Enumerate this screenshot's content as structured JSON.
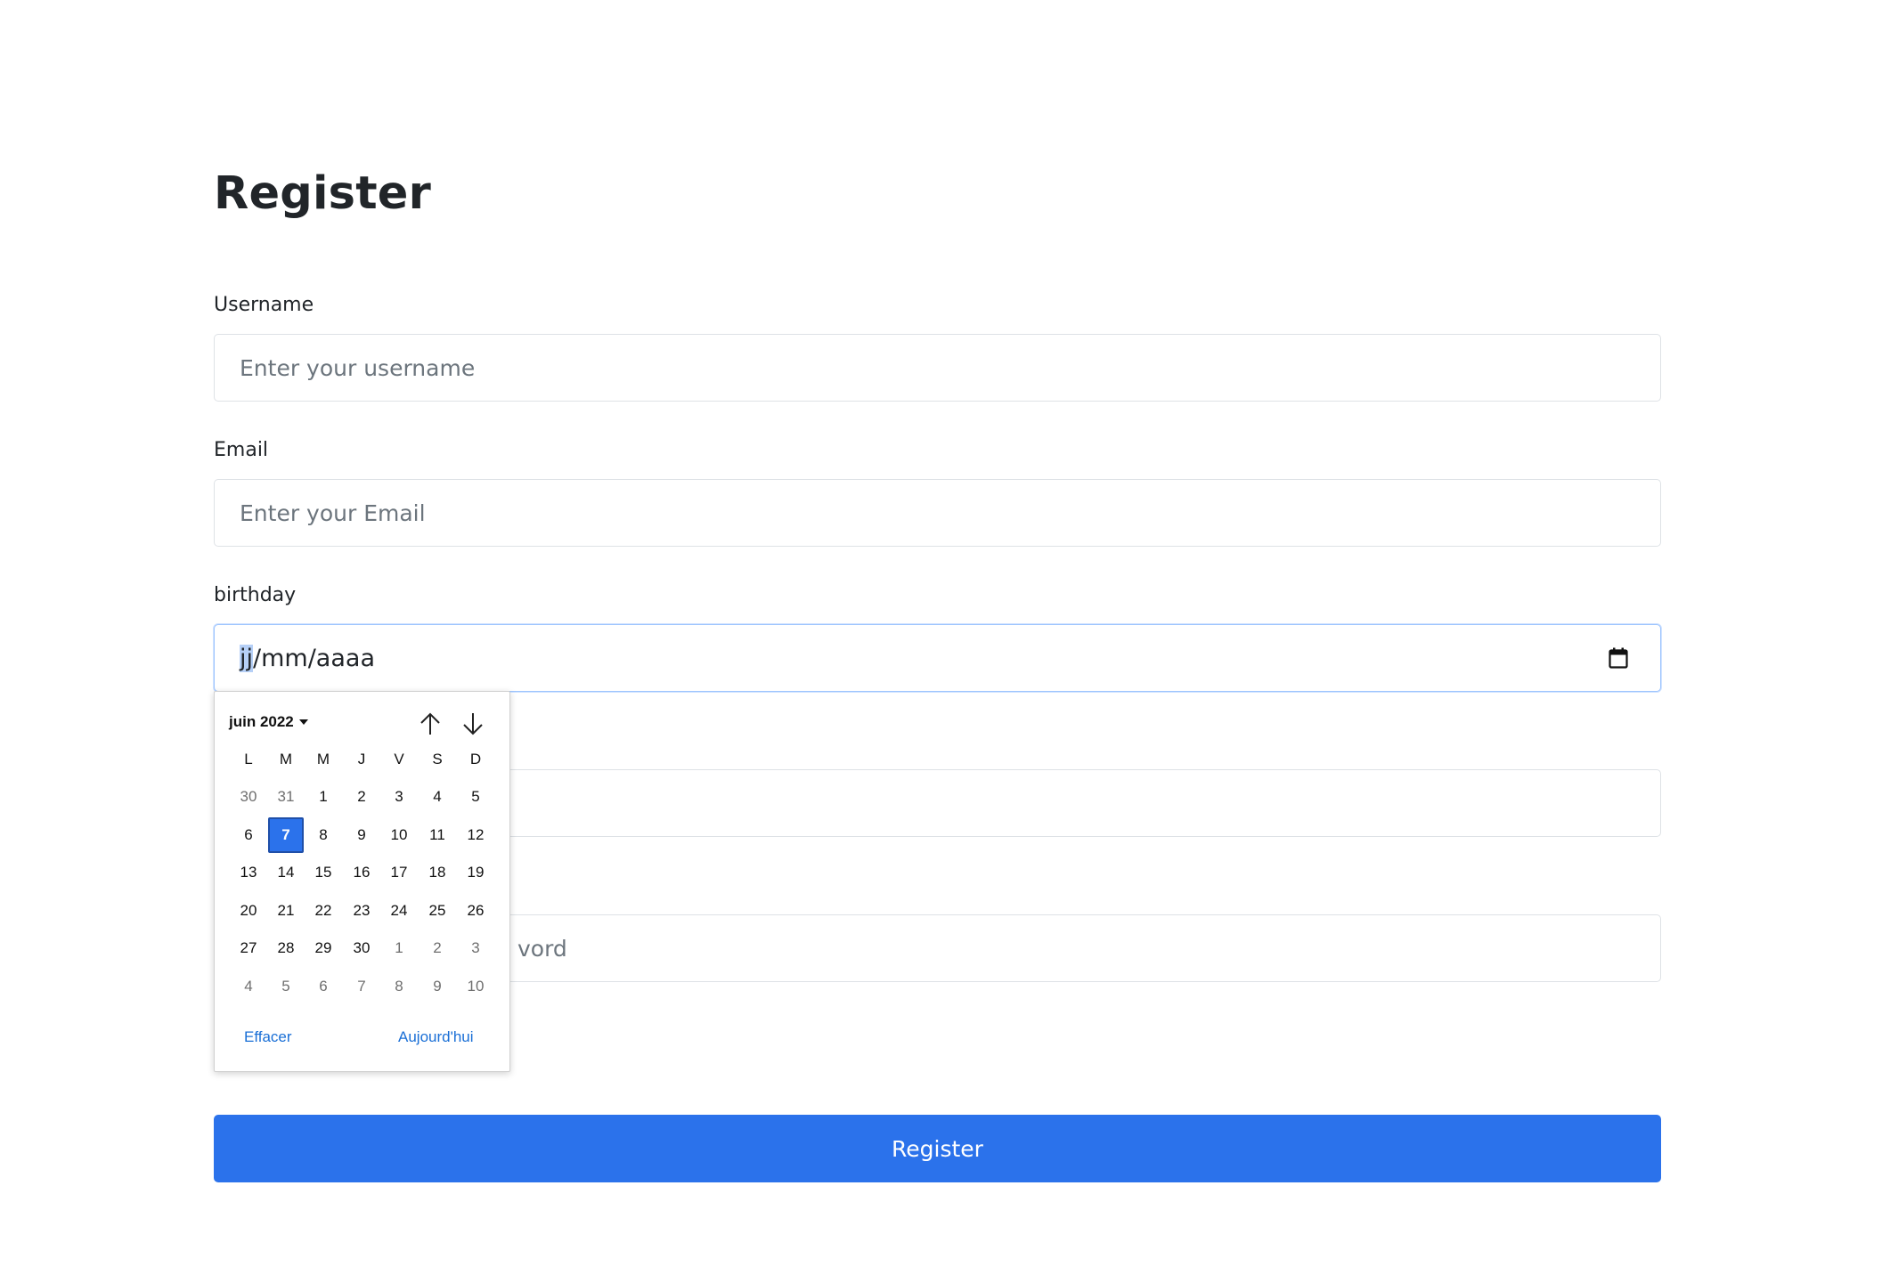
{
  "form": {
    "title": "Register",
    "username_label": "Username",
    "username_placeholder": "Enter your username",
    "email_label": "Email",
    "email_placeholder": "Enter your Email",
    "birthday_label": "birthday",
    "birthday_value_day": "jj",
    "birthday_value_rest": "/mm/aaaa",
    "password_partial": "vord",
    "submit_label": "Register"
  },
  "calendar": {
    "month_label": "juin 2022",
    "weekdays": [
      "L",
      "M",
      "M",
      "J",
      "V",
      "S",
      "D"
    ],
    "weeks": [
      [
        {
          "d": "30",
          "o": true
        },
        {
          "d": "31",
          "o": true
        },
        {
          "d": "1"
        },
        {
          "d": "2"
        },
        {
          "d": "3"
        },
        {
          "d": "4"
        },
        {
          "d": "5"
        }
      ],
      [
        {
          "d": "6"
        },
        {
          "d": "7",
          "s": true
        },
        {
          "d": "8"
        },
        {
          "d": "9"
        },
        {
          "d": "10"
        },
        {
          "d": "11"
        },
        {
          "d": "12"
        }
      ],
      [
        {
          "d": "13"
        },
        {
          "d": "14"
        },
        {
          "d": "15"
        },
        {
          "d": "16"
        },
        {
          "d": "17"
        },
        {
          "d": "18"
        },
        {
          "d": "19"
        }
      ],
      [
        {
          "d": "20"
        },
        {
          "d": "21"
        },
        {
          "d": "22"
        },
        {
          "d": "23"
        },
        {
          "d": "24"
        },
        {
          "d": "25"
        },
        {
          "d": "26"
        }
      ],
      [
        {
          "d": "27"
        },
        {
          "d": "28"
        },
        {
          "d": "29"
        },
        {
          "d": "30"
        },
        {
          "d": "1",
          "o": true
        },
        {
          "d": "2",
          "o": true
        },
        {
          "d": "3",
          "o": true
        }
      ],
      [
        {
          "d": "4",
          "o": true
        },
        {
          "d": "5",
          "o": true
        },
        {
          "d": "6",
          "o": true
        },
        {
          "d": "7",
          "o": true
        },
        {
          "d": "8",
          "o": true
        },
        {
          "d": "9",
          "o": true
        },
        {
          "d": "10",
          "o": true
        }
      ]
    ],
    "clear_label": "Effacer",
    "today_label": "Aujourd'hui"
  },
  "colors": {
    "accent": "#2b72eb",
    "link": "#1a6fd6"
  },
  "icons": {
    "calendar": "calendar-icon",
    "prev_month": "arrow-up-icon",
    "next_month": "arrow-down-icon",
    "month_dropdown": "caret-down-icon"
  }
}
